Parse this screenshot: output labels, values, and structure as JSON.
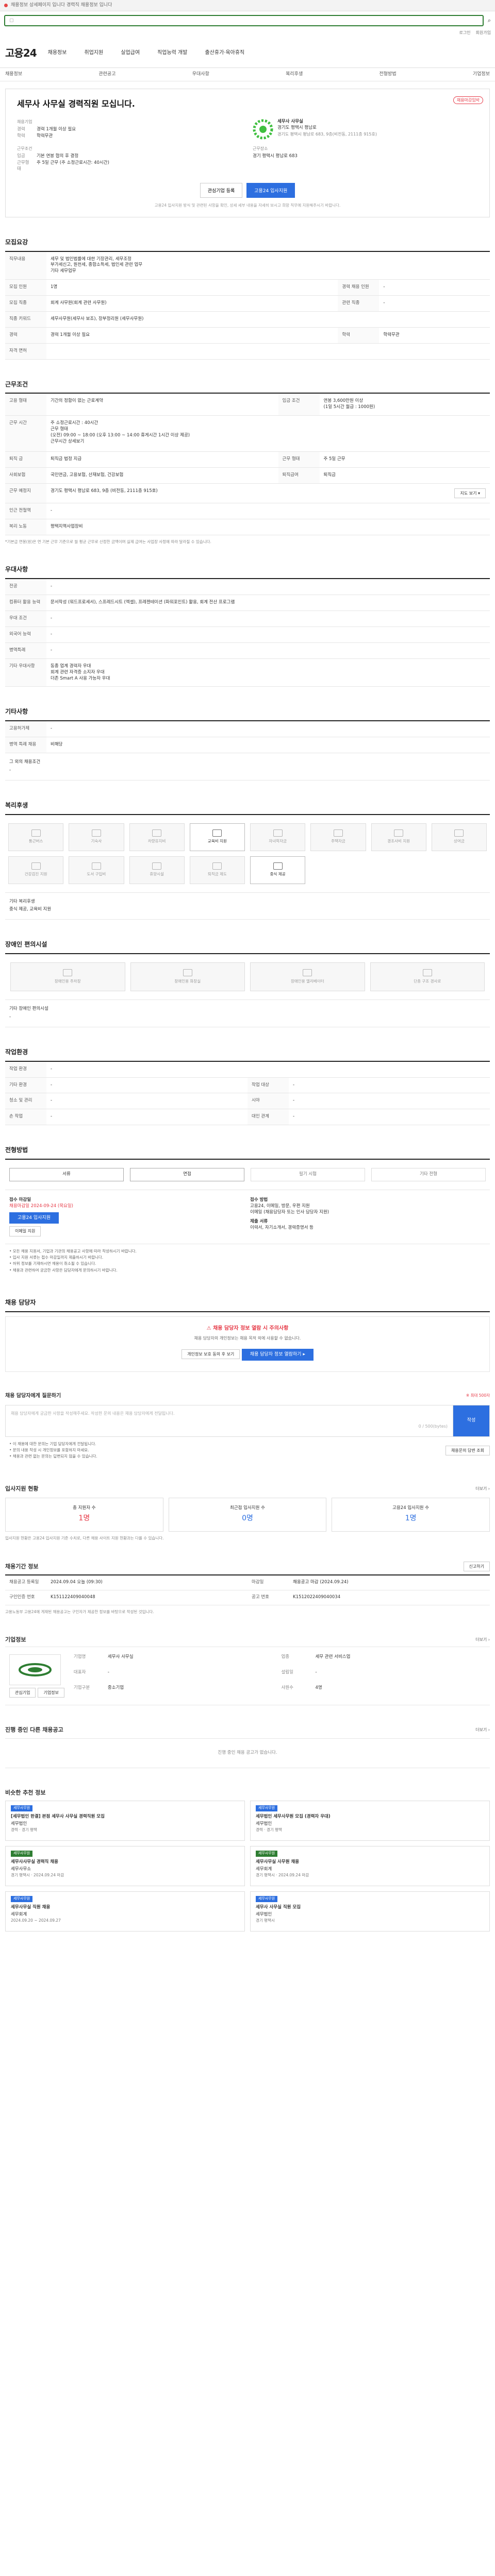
{
  "topbar": {
    "text": "채용정보 상세페이지 입니다 경력직 채용정보 입니다"
  },
  "util": [
    "로그인",
    "회원가입"
  ],
  "header": {
    "logo": "고용24",
    "nav": [
      "채용정보",
      "취업지원",
      "실업급여",
      "직업능력 개발",
      "출산휴가·육아휴직"
    ],
    "subnav": [
      "채용정보",
      "관련공고",
      "우대사항",
      "복리후생",
      "전형방법",
      "기업정보"
    ]
  },
  "summary": {
    "title": "세무사 사무실 경력직원 모십니다.",
    "badge": "채용마감임박",
    "company_label": "채용기업",
    "company_name": "세무사 사무실",
    "company_addr_line1": "경기도 평택시 평남로",
    "company_addr_line2": "경기도 평택시 평남로 683, 9층(비전동, 2111층 915호)",
    "rows": [
      {
        "k": "경력",
        "v": "경력 1개월 이상 필요"
      },
      {
        "k": "학력",
        "v": "학력무관"
      }
    ],
    "work_label": "근무조건",
    "work_rows": [
      {
        "k": "임금",
        "v": "기본 연봉 협의 후 결정"
      },
      {
        "k": "근무형태",
        "v": "주 5일 근무 (주 소정근로시간: 40시간)"
      }
    ],
    "place_label": "근무장소",
    "place_value": "경기 평택시 평남로 683",
    "btn_scrap": "관심기업 등록",
    "btn_apply": "고용24 입사지원",
    "note": "고용24 입사지원 방식 및 관련된 사항을 확인, 상세 세부 내용을 자세히 보시고 희망 직무에 지원해주시기 바랍니다."
  },
  "recruit": {
    "title": "모집요강",
    "job_title": "직무내용",
    "job_desc": "세무 및 법인법률에 대한 기장관리, 세무조정\n부가세신고, 원천세, 종합소득세, 법인세 관련 업무\n기타 세무업무",
    "rows": [
      {
        "k": "모집 인원",
        "v": "1명",
        "k2": "경력 채용 인원",
        "v2": "-"
      },
      {
        "k": "모집 직종",
        "v": "회계 사무원(회계 관련 사무원)",
        "k2": "관련 직종",
        "v2": "-"
      },
      {
        "k": "직종 키워드",
        "v": "세무사무원(세무사 보조), 장부정리원 (세무사무원)",
        "k2": "",
        "v2": ""
      },
      {
        "k": "경력",
        "v": "경력 1개월 이상 필요",
        "k2": "학력",
        "v2": "학력무관"
      },
      {
        "k": "자격 면허",
        "v": "",
        "k2": "",
        "v2": ""
      }
    ]
  },
  "work": {
    "title": "근무조건",
    "rows": [
      {
        "k": "고용 형태",
        "v": "기간의 정함이 없는 근로계약",
        "k2": "임금 조건",
        "v2": "연봉 3,600만원 이상\n(1일 5시간 월급 : 1000원)"
      },
      {
        "k": "근무 시간",
        "v": "주 소정근로시간 : 40시간\n근무 형태\n(오전) 09:00 ~ 18:00 (오후 13:00 ~ 14:00 휴게시간 1시간 이상 제공)\n근무시간 상세보기",
        "k2": "",
        "v2": ""
      },
      {
        "k": "퇴직 금",
        "v": "퇴직금 법정 지급",
        "k2": "근무 형태",
        "v2": "주 5일 근무"
      },
      {
        "k": "사회보험",
        "v": "국민연금, 고용보험, 산재보험, 건강보험",
        "k2": "퇴직급여",
        "v2": "퇴직금"
      },
      {
        "k": "근무 예정지",
        "v": "경기도 평택시 평남로 683, 9층 (비전동, 2111층 915호)",
        "k2": "",
        "v2": "지도 보기 ▾"
      },
      {
        "k": "인근 전철역",
        "v": "-",
        "k2": "",
        "v2": ""
      },
      {
        "k": "복리 노동",
        "v": "평택지역사업장비",
        "k2": "",
        "v2": ""
      }
    ],
    "note": "*기본급 연봉(원)은 연 기본 근무 기준으로 월 평균 근무로 산정한 금액이며 실제 급여는 사업장 사정에 따라 달라질 수 있습니다."
  },
  "prefer": {
    "title": "우대사항",
    "rows": [
      {
        "k": "전공",
        "v": "-"
      },
      {
        "k": "컴퓨터 활용 능력",
        "v": "문서작성 (워드프로세서), 스프레드시트 (엑셀), 프레젠테이션 (파워포인트) 활용, 회계 전산 프로그램"
      },
      {
        "k": "우대 조건",
        "v": "-"
      },
      {
        "k": "외국어 능력",
        "v": "-"
      },
      {
        "k": "병역특례",
        "v": "-"
      },
      {
        "k": "기타 우대사항",
        "v": "동종 업계 경력자 우대\n회계 관련 자격증 소지자 우대\n더존 Smart A 사용 가능자 우대"
      }
    ]
  },
  "extra": {
    "title": "기타사항",
    "rows": [
      {
        "k": "고용허가제",
        "v": "-"
      },
      {
        "k": "병역 특례 채용",
        "v": "비해당"
      }
    ],
    "sub_label": "그 외의 채용조건",
    "sub_value": "-"
  },
  "welfare": {
    "title": "복리후생",
    "items": [
      {
        "label": "통근버스",
        "on": false
      },
      {
        "label": "기숙사",
        "on": false
      },
      {
        "label": "차량유지비",
        "on": false
      },
      {
        "label": "교육비 지원",
        "on": true
      },
      {
        "label": "자녀학자금",
        "on": false
      },
      {
        "label": "주택자금",
        "on": false
      },
      {
        "label": "경조사비 지원",
        "on": false
      },
      {
        "label": "상여금",
        "on": false
      },
      {
        "label": "건강검진 지원",
        "on": false
      },
      {
        "label": "도서 구입비",
        "on": false
      },
      {
        "label": "휴양시설",
        "on": false
      },
      {
        "label": "퇴직금 제도",
        "on": false
      },
      {
        "label": "중식 제공",
        "on": true
      }
    ],
    "other_label": "기타 복리후생",
    "other_value": "중식 제공, 교육비 지원"
  },
  "disability": {
    "title": "장애인 편의시설",
    "items": [
      "장애인용 주차장",
      "장애인용 화장실",
      "장애인용 엘리베이터",
      "단층 구조 경사로"
    ],
    "other_label": "기타 장애인 편의시설",
    "other_value": "-"
  },
  "job_env": {
    "title": "작업환경",
    "rows": [
      {
        "k": "작업 환경",
        "v": "-",
        "k2": "",
        "v2": ""
      },
      {
        "k": "기타 환경",
        "v": "-",
        "k2": "작업 대상",
        "v2": "-"
      },
      {
        "k": "청소 및 관리",
        "v": "-",
        "k2": "시야",
        "v2": "-"
      },
      {
        "k": "손 작업",
        "v": "-",
        "k2": "대인 관계",
        "v2": "-"
      }
    ]
  },
  "process": {
    "title": "전형방법",
    "steps": [
      {
        "label": "서류",
        "on": true
      },
      {
        "label": "면접",
        "on": true
      },
      {
        "label": "필기 시험",
        "on": false
      },
      {
        "label": "기타 전형",
        "on": false
      }
    ]
  },
  "apply": {
    "deadline_label": "접수 마감일",
    "deadline": "채용마감일 2024-09-24 (목요일)",
    "apply_btn": "고용24 입사지원",
    "email_btn": "이메일 지원",
    "method_label": "접수 방법",
    "method_value": "고용24, 이메일, 방문, 우편 지원",
    "method_value2": "이메일 (채용담당자 또는 인사 담당자 지원)",
    "docs_label": "제출 서류",
    "docs_value": "이력서, 자기소개서, 경력증명서 등",
    "bullets": [
      "• 모든 채용 지원서, 기업과 기관의 채용공고 사항에 따라 작성하시기 바랍니다.",
      "• 입사 지원 서류는 접수 마감일까지 제출하시기 바랍니다.",
      "• 허위 정보를 기재하시면 채용이 취소될 수 있습니다.",
      "• 채용과 관련하여 궁금한 사항은 담당자에게 문의하시기 바랍니다."
    ]
  },
  "manager": {
    "title": "채용 담당자",
    "alert": "채용 담당자 정보 열람 시 주의사항",
    "alert_desc": "채용 담당자의 개인정보는 채용 목적 외에 사용할 수 없습니다.",
    "btn1": "개인정보 보호 동의 후 보기",
    "btn2": "채용 담당자 정보 열람하기 ▸"
  },
  "inquiry": {
    "title": "채용 담당자에게 질문하기",
    "hint": "※ 최대 500자",
    "placeholder": "채용 담당자에게 궁금한 사항을 작성해주세요. 작성한 문의 내용은 채용 담당자에게 전달됩니다.",
    "count": "0 / 500(bytes)",
    "submit": "작성",
    "bullets": [
      "• 이 채용에 대한 문의는 기업 담당자에게 전달됩니다.",
      "• 문의 내용 작성 시 개인정보를 포함하지 마세요.",
      "• 채용과 관련 없는 문의는 답변되지 않을 수 있습니다."
    ],
    "side_btn": "채용문의 답변 조회"
  },
  "applicants": {
    "title": "입사지원 현황",
    "more": "더보기 ›",
    "stats": [
      {
        "label": "총 지원자 수",
        "value": "1명",
        "red": true
      },
      {
        "label": "최근접 입사지원 수",
        "value": "0명",
        "red": false
      },
      {
        "label": "고용24 입사지원 수",
        "value": "1명",
        "red": false
      }
    ],
    "note": "입사지원 현황은 고용24 입사지원 기준 수치로, 다른 채용 사이트 지원 현황과는 다를 수 있습니다."
  },
  "recruit_info": {
    "title": "채용기간 정보",
    "report_btn": "신고하기",
    "rows": [
      {
        "k": "채용공고 등록일",
        "v": "2024.09.04 오늘 (09:30)",
        "k2": "마감일",
        "v2": "채용공고 마감 (2024.09.24)"
      },
      {
        "k": "구인인증 번호",
        "v": "K151122409040048",
        "k2": "공고 번호",
        "v2": "K1512022409040034"
      }
    ],
    "note": "고용노동부 고용24에 게재된 채용공고는 구인자가 제공한 정보를 바탕으로 작성된 것입니다."
  },
  "corp": {
    "title": "기업정보",
    "more": "더보기 ›",
    "logo_text": "기업 로고",
    "follow": "관심기업",
    "name_btn": "기업정보",
    "rows": [
      {
        "k": "기업명",
        "v": "세무사 사무실",
        "k2": "업종",
        "v2": "세무 관련 서비스업"
      },
      {
        "k": "대표자",
        "v": "-",
        "k2": "설립일",
        "v2": "-"
      },
      {
        "k": "기업구분",
        "v": "중소기업",
        "k2": "사원수",
        "v2": "4명"
      }
    ]
  },
  "other_jobs": {
    "title": "진행 중인 다른 채용공고",
    "more": "더보기 ›",
    "empty": "진행 중인 채용 공고가 없습니다."
  },
  "recommend": {
    "title": "비슷한 추천 정보",
    "jobs": [
      {
        "tag": "세무사무원",
        "color": "#2d6fe0",
        "title": "[세무법인 한결] 본점 세무사 사무실 경력직원 모집",
        "company": "세무법인",
        "meta": "경력 · 경기 평택"
      },
      {
        "tag": "세무사무원",
        "color": "#2d6fe0",
        "title": "세무법인 세무사무원 모집 (경력자 우대)",
        "company": "세무법인",
        "meta": "경력 · 경기 평택"
      },
      {
        "tag": "세무사무원",
        "color": "#2e7d32",
        "title": "세무사사무실 경력직 채용",
        "company": "세무사무소",
        "meta": "경기 평택시 · 2024.09.24 마감"
      },
      {
        "tag": "세무사무원",
        "color": "#2e7d32",
        "title": "세무사무실 사무원 채용",
        "company": "세무회계",
        "meta": "경기 평택시 · 2024.09.24 마감"
      },
      {
        "tag": "세무사무원",
        "color": "#2d6fe0",
        "title": "세무사무실 직원 채용",
        "company": "세무회계",
        "meta": "2024.09.20 ~ 2024.09.27"
      },
      {
        "tag": "세무사무원",
        "color": "#2d6fe0",
        "title": "세무사 사무실 직원 모집",
        "company": "세무법인",
        "meta": "경기 평택시"
      }
    ]
  }
}
